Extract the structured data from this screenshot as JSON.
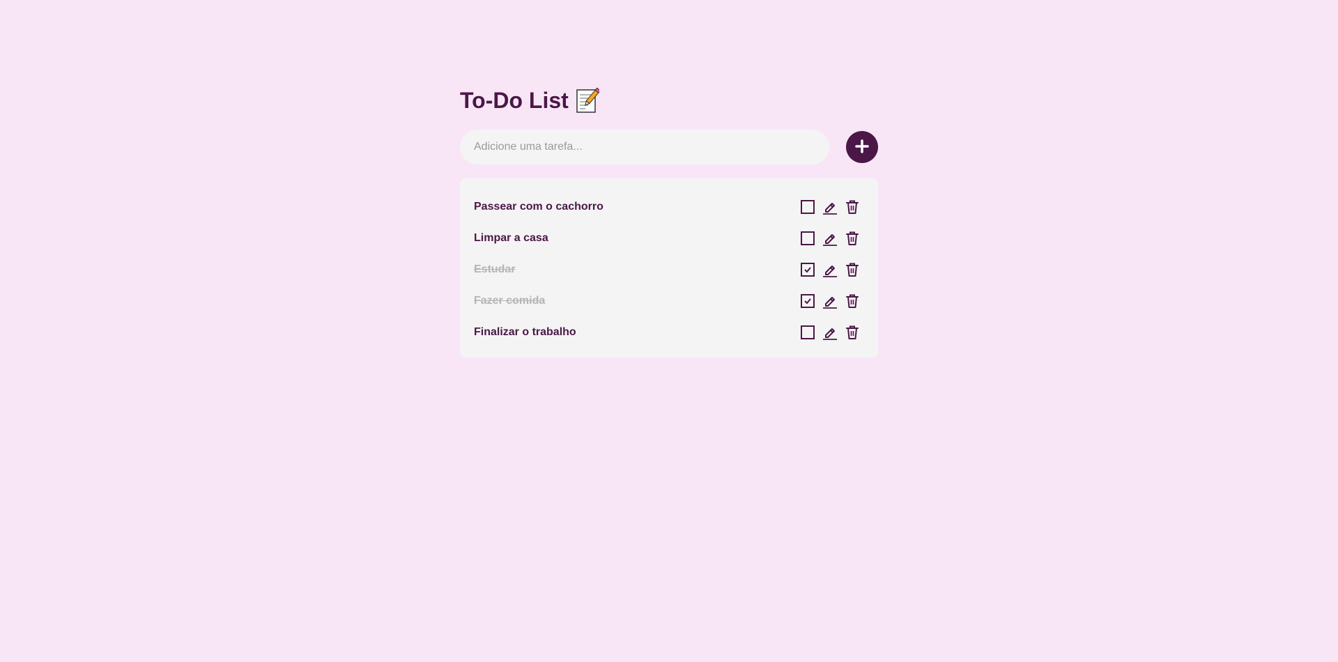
{
  "app": {
    "title": "To-Do List",
    "title_icon": "memo-icon"
  },
  "add_task": {
    "placeholder": "Adicione uma tarefa...",
    "value": "",
    "button_icon": "plus-icon"
  },
  "colors": {
    "background": "#f8e6f6",
    "accent": "#4a1747",
    "panel": "#f4f4f4",
    "done_text": "#b5b5b5"
  },
  "tasks": [
    {
      "text": "Passear com o cachorro",
      "done": false
    },
    {
      "text": "Limpar a casa",
      "done": false
    },
    {
      "text": "Estudar",
      "done": true
    },
    {
      "text": "Fazer comida",
      "done": true
    },
    {
      "text": "Finalizar o trabalho",
      "done": false
    }
  ]
}
